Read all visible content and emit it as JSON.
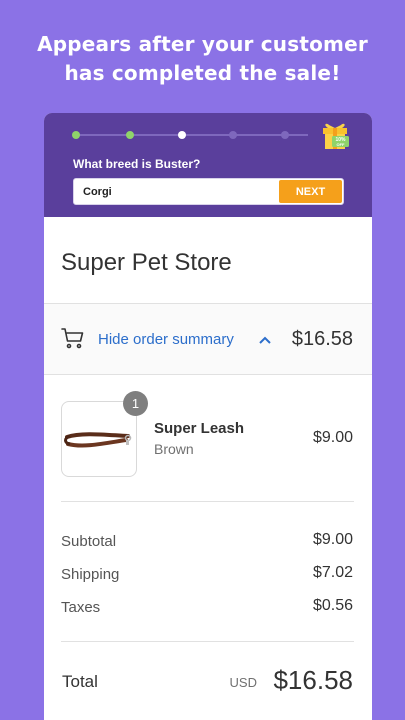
{
  "promo": {
    "headline_line1": "Appears after your customer",
    "headline_line2": "has completed the sale!"
  },
  "survey": {
    "question": "What breed is Buster?",
    "answer": "Corgi",
    "next_label": "NEXT",
    "gift_badge": "10% OFF",
    "progress": {
      "completed_steps": 2,
      "current_step": 3,
      "total_steps": 5
    },
    "colors": {
      "background": "#5a3f9c",
      "button": "#f5a01b",
      "done_dot": "#8fd46a"
    }
  },
  "store": {
    "name": "Super Pet Store"
  },
  "order_summary": {
    "toggle_label": "Hide order summary",
    "total": "$16.58",
    "cart_icon": "cart-icon",
    "chevron_icon": "chevron-up-icon"
  },
  "items": [
    {
      "quantity": "1",
      "name": "Super Leash",
      "variant": "Brown",
      "price": "$9.00"
    }
  ],
  "costs": {
    "subtotal_label": "Subtotal",
    "subtotal": "$9.00",
    "shipping_label": "Shipping",
    "shipping": "$7.02",
    "taxes_label": "Taxes",
    "taxes": "$0.56"
  },
  "total": {
    "label": "Total",
    "currency": "USD",
    "amount": "$16.58"
  },
  "colors": {
    "page_background": "#8b72e6",
    "link": "#2c6ecb"
  }
}
